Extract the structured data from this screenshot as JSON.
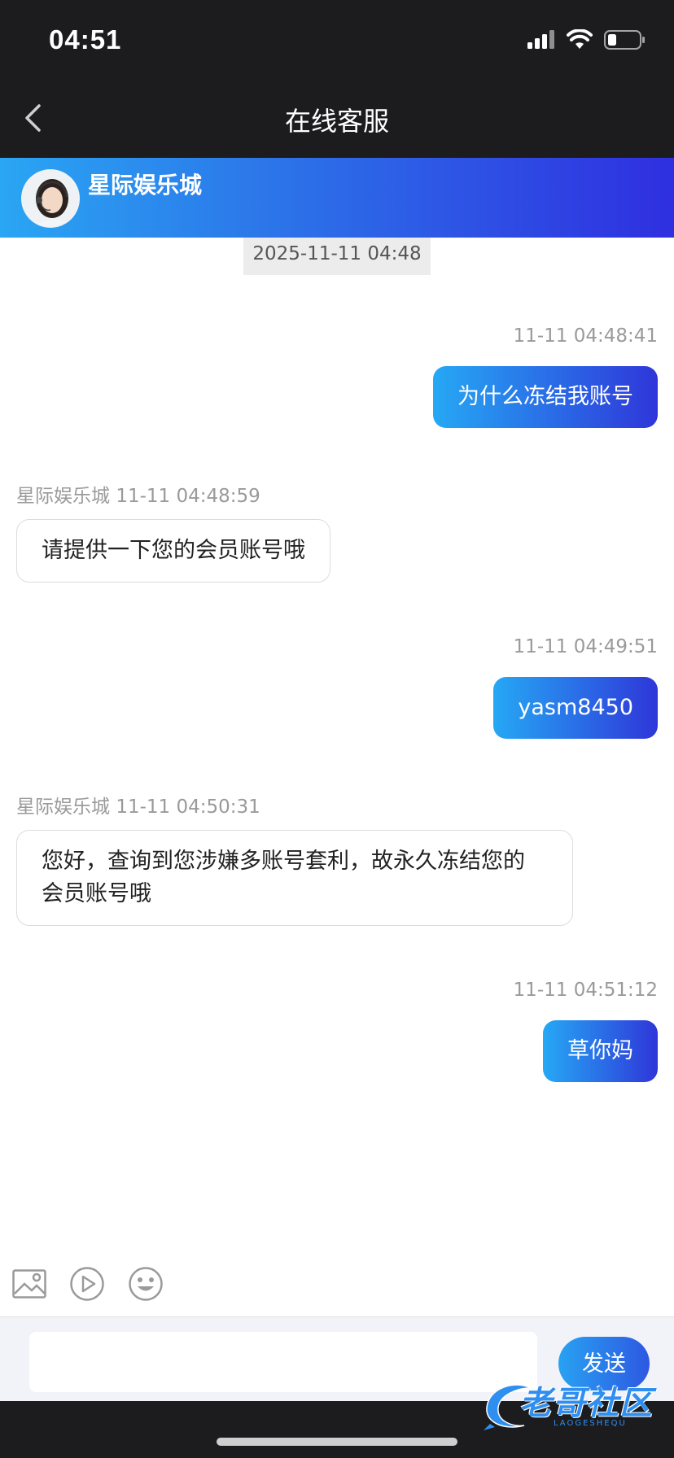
{
  "status_bar": {
    "time": "04:51"
  },
  "nav": {
    "title": "在线客服"
  },
  "agent": {
    "name": "星际娱乐城"
  },
  "chat": {
    "date_divider": "2025-11-11 04:48",
    "messages": [
      {
        "side": "out",
        "time": "11-11 04:48:41",
        "text": "为什么冻结我账号"
      },
      {
        "side": "in",
        "sender": "星际娱乐城",
        "time": "11-11 04:48:59",
        "text": "请提供一下您的会员账号哦"
      },
      {
        "side": "out",
        "time": "11-11 04:49:51",
        "text": "yasm8450"
      },
      {
        "side": "in",
        "sender": "星际娱乐城",
        "time": "11-11 04:50:31",
        "text_line1": "您好，查询到您涉嫌多账号套利，故永久冻结您的",
        "text_line2": "会员账号哦"
      },
      {
        "side": "out",
        "time": "11-11 04:51:12",
        "text": "草你妈"
      }
    ]
  },
  "composer": {
    "input_value": "",
    "send_label": "发送"
  },
  "watermark": {
    "text": "老哥社区",
    "sub": "LAOGESHEQU"
  }
}
